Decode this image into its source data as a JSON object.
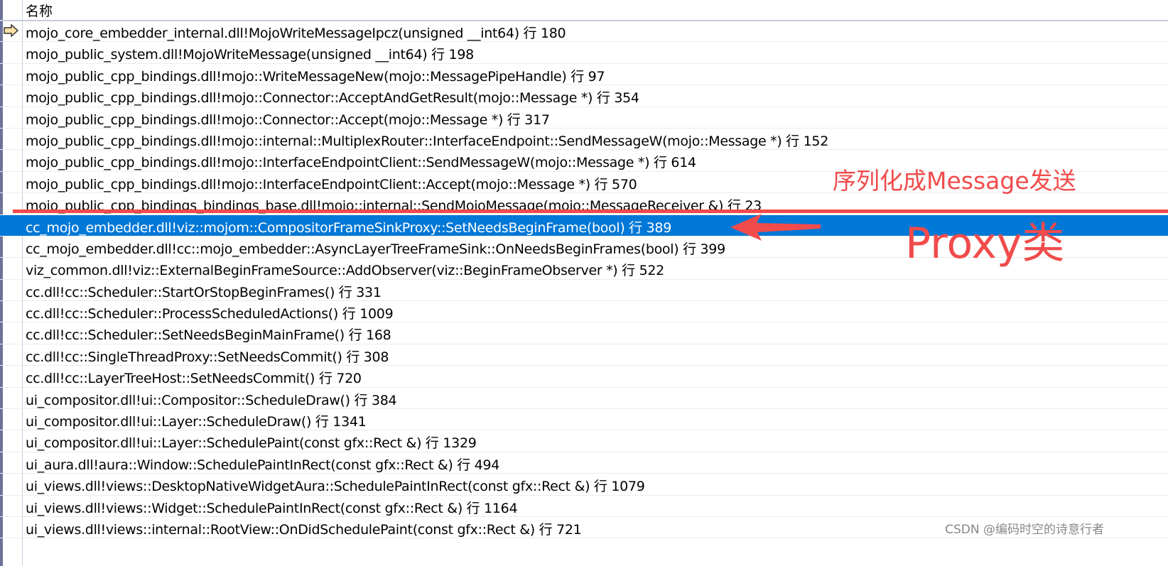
{
  "header": {
    "column_name": "名称"
  },
  "current_frame_icon": "yellow-arrow-icon",
  "selected_index": 9,
  "frames": [
    "mojo_core_embedder_internal.dll!MojoWriteMessageIpcz(unsigned __int64) 行 180",
    "mojo_public_system.dll!MojoWriteMessage(unsigned __int64) 行 198",
    "mojo_public_cpp_bindings.dll!mojo::WriteMessageNew(mojo::MessagePipeHandle) 行 97",
    "mojo_public_cpp_bindings.dll!mojo::Connector::AcceptAndGetResult(mojo::Message *) 行 354",
    "mojo_public_cpp_bindings.dll!mojo::Connector::Accept(mojo::Message *) 行 317",
    "mojo_public_cpp_bindings.dll!mojo::internal::MultiplexRouter::InterfaceEndpoint::SendMessageW(mojo::Message *) 行 152",
    "mojo_public_cpp_bindings.dll!mojo::InterfaceEndpointClient::SendMessageW(mojo::Message *) 行 614",
    "mojo_public_cpp_bindings.dll!mojo::InterfaceEndpointClient::Accept(mojo::Message *) 行 570",
    "mojo_public_cpp_bindings_bindings_base.dll!mojo::internal::SendMojoMessage(mojo::MessageReceiver &) 行 23",
    "cc_mojo_embedder.dll!viz::mojom::CompositorFrameSinkProxy::SetNeedsBeginFrame(bool) 行 389",
    "cc_mojo_embedder.dll!cc::mojo_embedder::AsyncLayerTreeFrameSink::OnNeedsBeginFrames(bool) 行 399",
    "viz_common.dll!viz::ExternalBeginFrameSource::AddObserver(viz::BeginFrameObserver *) 行 522",
    "cc.dll!cc::Scheduler::StartOrStopBeginFrames() 行 331",
    "cc.dll!cc::Scheduler::ProcessScheduledActions() 行 1009",
    "cc.dll!cc::Scheduler::SetNeedsBeginMainFrame() 行 168",
    "cc.dll!cc::SingleThreadProxy::SetNeedsCommit() 行 308",
    "cc.dll!cc::LayerTreeHost::SetNeedsCommit() 行 720",
    "ui_compositor.dll!ui::Compositor::ScheduleDraw() 行 384",
    "ui_compositor.dll!ui::Layer::ScheduleDraw() 行 1341",
    "ui_compositor.dll!ui::Layer::SchedulePaint(const gfx::Rect &) 行 1329",
    "ui_aura.dll!aura::Window::SchedulePaintInRect(const gfx::Rect &) 行 494",
    "ui_views.dll!views::DesktopNativeWidgetAura::SchedulePaintInRect(const gfx::Rect &) 行 1079",
    "ui_views.dll!views::Widget::SchedulePaintInRect(const gfx::Rect &) 行 1164",
    "ui_views.dll!views::internal::RootView::OnDidSchedulePaint(const gfx::Rect &) 行 721"
  ],
  "annotations": {
    "serialize": "序列化成Message发送",
    "proxy": "Proxy类",
    "color": "#f24b4b"
  },
  "watermark": "CSDN @编码时空的诗意行者",
  "colors": {
    "selection": "#0078d7"
  }
}
